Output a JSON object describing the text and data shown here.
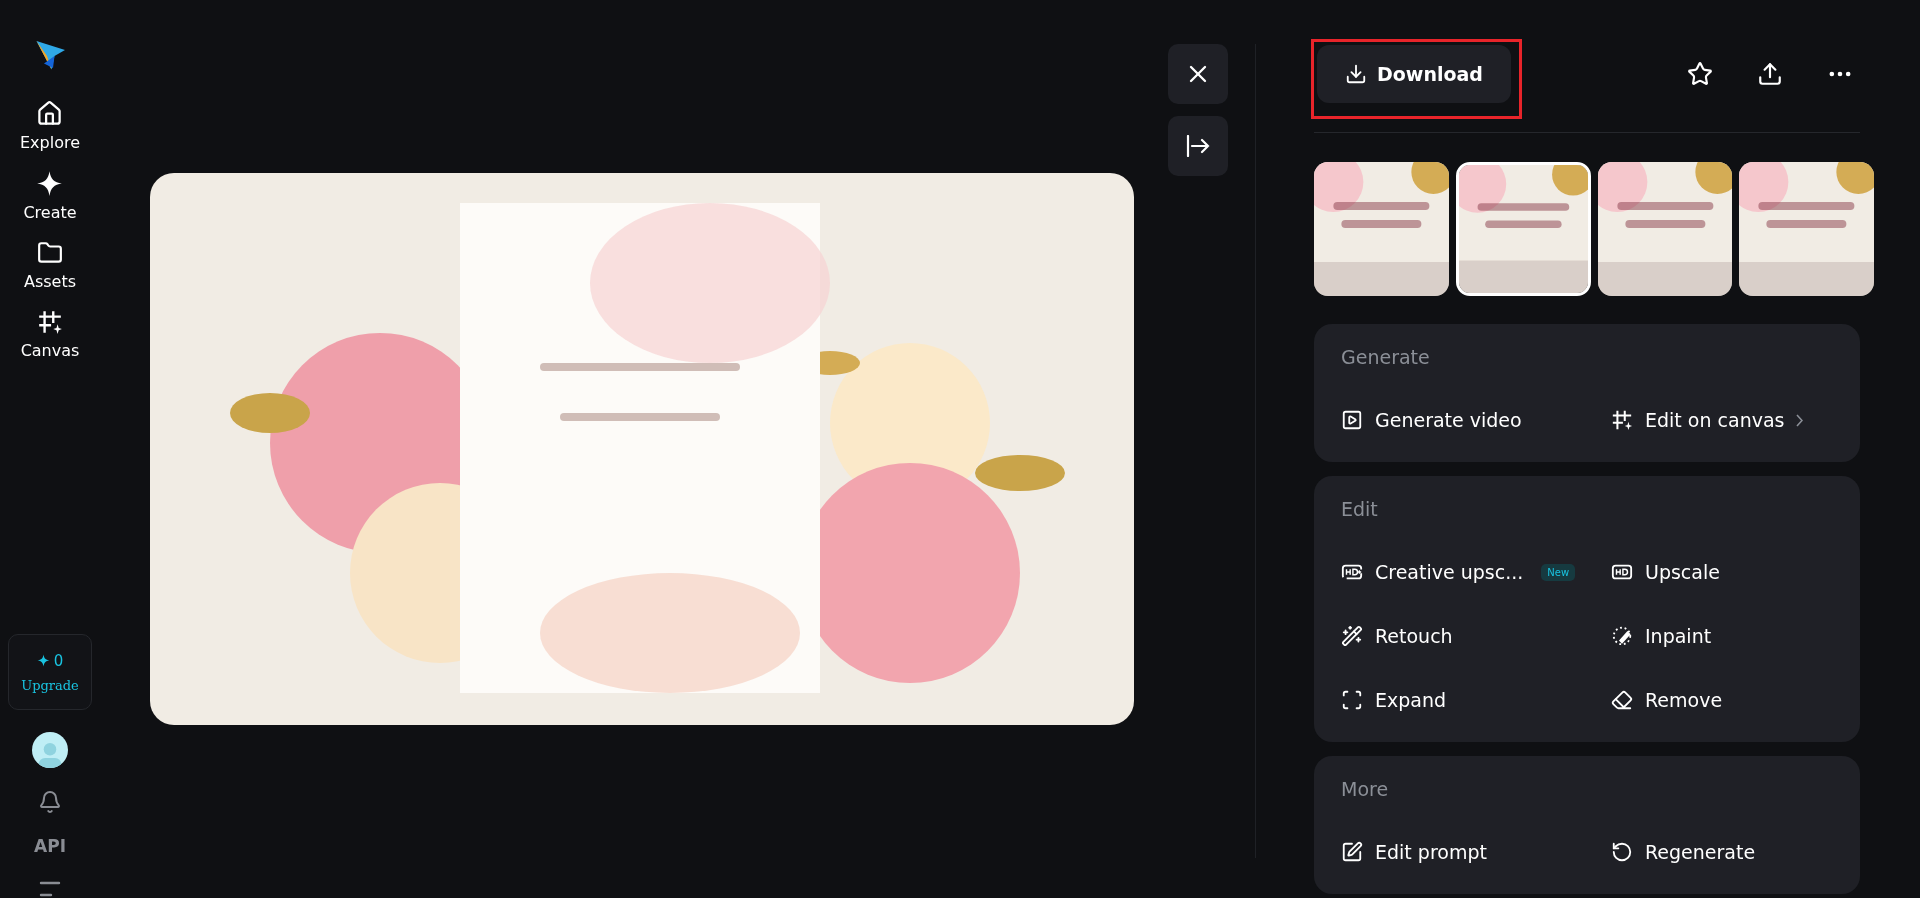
{
  "sidebar": {
    "items": [
      {
        "kind": "home",
        "label": "Explore"
      },
      {
        "kind": "sparkle",
        "label": "Create"
      },
      {
        "kind": "folder",
        "label": "Assets"
      },
      {
        "kind": "canvas",
        "label": "Canvas"
      }
    ],
    "credits": {
      "count": "0",
      "label": "Upgrade"
    },
    "api_label": "API"
  },
  "header": {
    "download_label": "Download",
    "highlighted": true
  },
  "thumbnails": [
    {
      "selected": false
    },
    {
      "selected": true
    },
    {
      "selected": false
    },
    {
      "selected": false
    }
  ],
  "sections": [
    {
      "title": "Generate",
      "actions": [
        {
          "kind": "video",
          "label": "Generate video"
        },
        {
          "kind": "canvas",
          "label": "Edit on canvas",
          "chevron": true
        }
      ]
    },
    {
      "title": "Edit",
      "actions": [
        {
          "kind": "hdplus",
          "label": "Creative upsc...",
          "badge": "New"
        },
        {
          "kind": "hd",
          "label": "Upscale"
        },
        {
          "kind": "wand",
          "label": "Retouch"
        },
        {
          "kind": "inpaint",
          "label": "Inpaint"
        },
        {
          "kind": "expand",
          "label": "Expand"
        },
        {
          "kind": "eraser",
          "label": "Remove"
        }
      ]
    },
    {
      "title": "More",
      "actions": [
        {
          "kind": "prompt",
          "label": "Edit prompt"
        },
        {
          "kind": "regen",
          "label": "Regenerate"
        }
      ]
    }
  ]
}
